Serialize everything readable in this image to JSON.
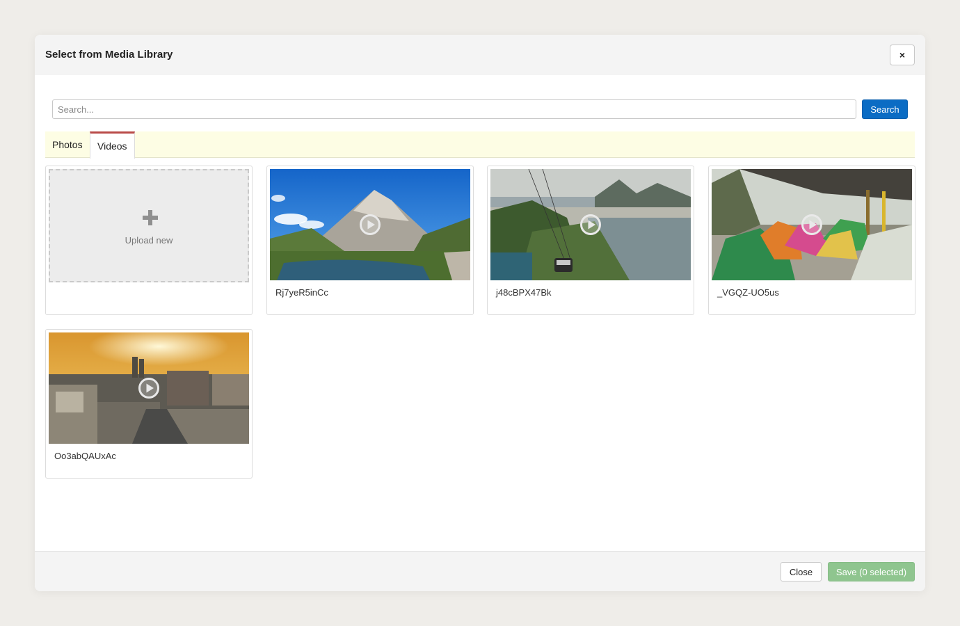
{
  "modal": {
    "title": "Select from Media Library",
    "close_icon": "×"
  },
  "search": {
    "placeholder": "Search...",
    "value": "",
    "button_label": "Search"
  },
  "tabs": [
    {
      "label": "Photos",
      "active": false
    },
    {
      "label": "Videos",
      "active": true
    }
  ],
  "upload": {
    "label": "Upload new",
    "icon": "plus-icon"
  },
  "media": [
    {
      "name": "Rj7yeR5inCc",
      "scene": "mountain-river",
      "icon": "play-icon"
    },
    {
      "name": "j48cBPX47Bk",
      "scene": "cable-car-bay",
      "icon": "play-icon"
    },
    {
      "name": "_VGQZ-UO5us",
      "scene": "camping-tents",
      "icon": "play-icon"
    },
    {
      "name": "Oo3abQAUxAc",
      "scene": "city-sunset",
      "icon": "play-icon"
    }
  ],
  "footer": {
    "close_label": "Close",
    "save_label": "Save (0 selected)"
  },
  "colors": {
    "primary": "#0b6cc4",
    "success_disabled": "#8fc58f",
    "active_tab_accent": "#b94a48",
    "tabbar_bg": "#fdfde4"
  }
}
